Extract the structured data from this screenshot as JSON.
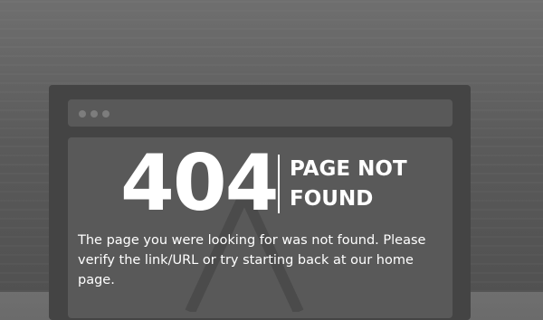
{
  "error": {
    "code": "404",
    "title": "PAGE NOT FOUND",
    "message": "The page you were looking for was not found. Please verify the link/URL or try starting back at our home page."
  },
  "illustration": {
    "icons": [
      "window-dot-icon",
      "window-dot-icon",
      "window-dot-icon",
      "triangle-outline-icon"
    ]
  },
  "colors": {
    "background_top": "#6f6f6f",
    "background_bottom": "#515151",
    "frame": "#444444",
    "pane": "#595959",
    "text": "#ffffff"
  }
}
